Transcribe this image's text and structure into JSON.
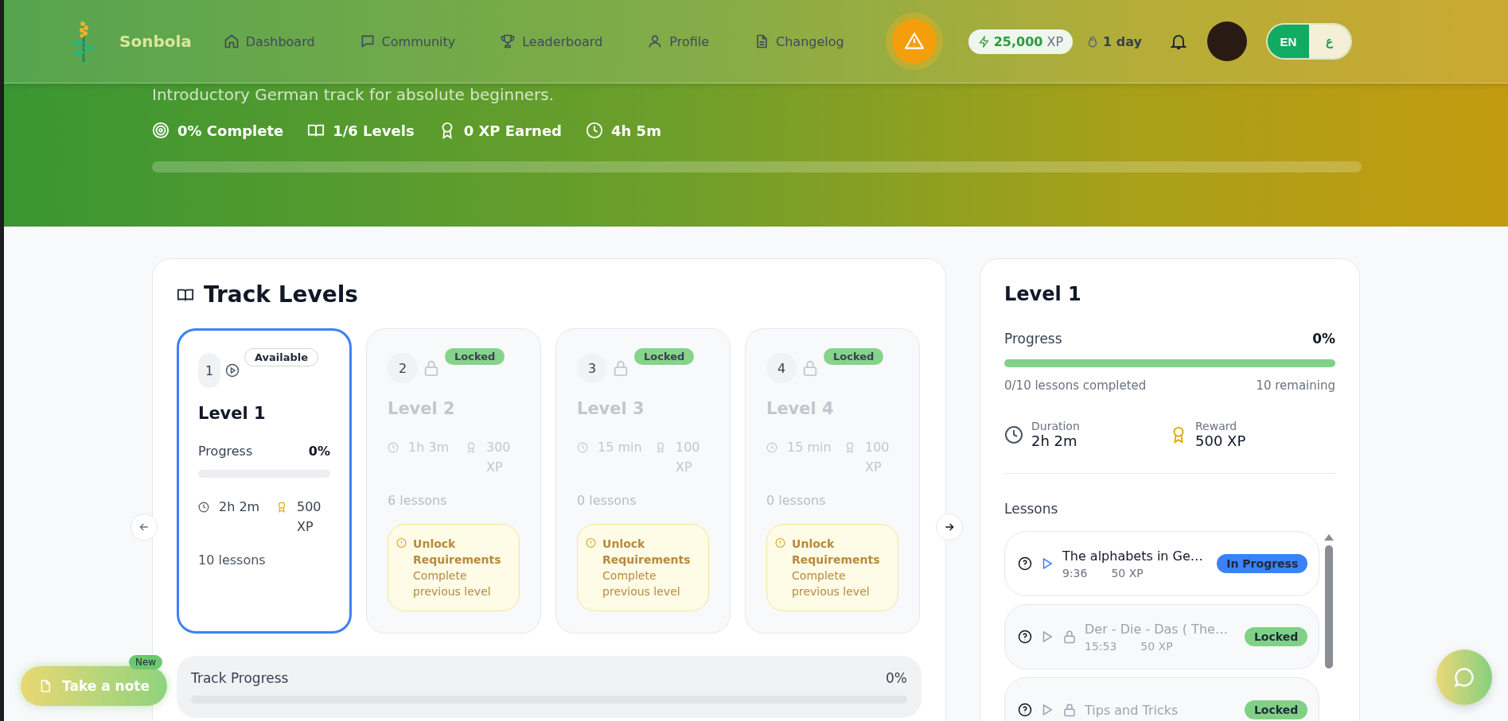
{
  "header": {
    "brand": "Sonbola",
    "nav": [
      {
        "label": "Dashboard"
      },
      {
        "label": "Community"
      },
      {
        "label": "Leaderboard"
      },
      {
        "label": "Profile"
      },
      {
        "label": "Changelog"
      }
    ],
    "xp": {
      "value": "25,000",
      "unit": "XP"
    },
    "streak": "1 day",
    "languages": [
      {
        "label": "EN",
        "selected": true
      },
      {
        "label": "ع",
        "selected": false
      }
    ]
  },
  "hero": {
    "subtitle": "Introductory German track for absolute beginners.",
    "stats": [
      {
        "kind": "target",
        "text": "0% Complete"
      },
      {
        "kind": "book",
        "text": "1/6 Levels"
      },
      {
        "kind": "award",
        "text": "0 XP Earned"
      },
      {
        "kind": "clock",
        "text": "4h 5m"
      }
    ],
    "level": 0
  },
  "track_levels": {
    "title": "Track Levels",
    "levels": [
      {
        "number": "1",
        "status": "Available",
        "locked": false,
        "selected": true,
        "title": "Level 1",
        "progress_label": "Progress",
        "progress_value": "0%",
        "level": 0,
        "duration": "2h 2m",
        "xp": "500 XP",
        "lessons": "10 lessons"
      },
      {
        "number": "2",
        "status": "Locked",
        "locked": true,
        "selected": false,
        "title": "Level 2",
        "duration": "1h 3m",
        "xp": "300 XP",
        "lessons": "6 lessons",
        "requirement_title": "Unlock Requirements",
        "requirement_text": "Complete previous level"
      },
      {
        "number": "3",
        "status": "Locked",
        "locked": true,
        "selected": false,
        "title": "Level 3",
        "duration": "15 min",
        "xp": "100 XP",
        "lessons": "0 lessons",
        "requirement_title": "Unlock Requirements",
        "requirement_text": "Complete previous level"
      },
      {
        "number": "4",
        "status": "Locked",
        "locked": true,
        "selected": false,
        "title": "Level 4",
        "duration": "15 min",
        "xp": "100 XP",
        "lessons": "0 lessons",
        "requirement_title": "Unlock Requirements",
        "requirement_text": "Complete previous level"
      }
    ],
    "track_progress": {
      "label": "Track Progress",
      "value": "0%",
      "level": 0
    }
  },
  "detail": {
    "title": "Level 1",
    "progress_label": "Progress",
    "progress_value": "0%",
    "level": 1,
    "completed": "0/10 lessons completed",
    "remaining": "10 remaining",
    "duration_label": "Duration",
    "duration": "2h 2m",
    "reward_label": "Reward",
    "reward": "500 XP",
    "lessons_label": "Lessons",
    "lessons": [
      {
        "title": "The alphabets in Ge…",
        "duration": "9:36",
        "xp": "50 XP",
        "status": "In Progress",
        "locked": false
      },
      {
        "title": "Der - Die - Das ( The…",
        "duration": "15:53",
        "xp": "50 XP",
        "status": "Locked",
        "locked": true
      },
      {
        "title": "Tips and Tricks",
        "status": "Locked",
        "locked": true
      }
    ]
  },
  "note_button": {
    "label": "Take a note",
    "badge": "New"
  }
}
